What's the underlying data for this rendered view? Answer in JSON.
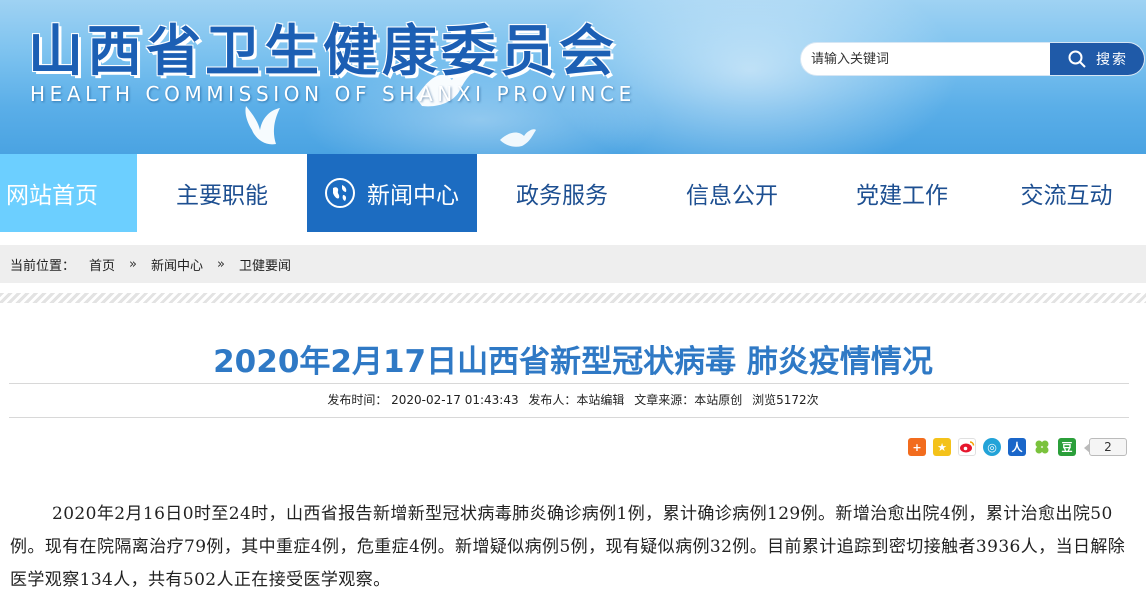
{
  "header": {
    "title": "山西省卫生健康委员会",
    "subtitle": "HEALTH COMMISSION OF SHANXI PROVINCE",
    "search_placeholder": "请输入关键词",
    "search_button": "搜索"
  },
  "nav": {
    "items": [
      {
        "label": "网站首页"
      },
      {
        "label": "主要职能"
      },
      {
        "label": "新闻中心"
      },
      {
        "label": "政务服务"
      },
      {
        "label": "信息公开"
      },
      {
        "label": "党建工作"
      },
      {
        "label": "交流互动"
      }
    ],
    "active_index": 2
  },
  "breadcrumb": {
    "label": "当前位置：",
    "items": [
      "首页",
      "新闻中心",
      "卫健要闻"
    ],
    "separator": "»"
  },
  "article": {
    "title": "2020年2月17日山西省新型冠状病毒 肺炎疫情情况",
    "meta": {
      "publish_time": "发布时间：  2020-02-17 01:43:43",
      "publisher": "发布人：本站编辑",
      "source": "文章来源：本站原创",
      "views": "浏览5172次"
    },
    "share_count": "2",
    "body": "2020年2月16日0时至24时，山西省报告新增新型冠状病毒肺炎确诊病例1例，累计确诊病例129例。新增治愈出院4例，累计治愈出院50例。现有在院隔离治疗79例，其中重症4例，危重症4例。新增疑似病例5例，现有疑似病例32例。目前累计追踪到密切接触者3936人，当日解除医学观察134人，共有502人正在接受医学观察。"
  },
  "colors": {
    "brand_blue": "#1c5fb4",
    "nav_active": "#1c6cc1",
    "nav_home": "#6ccfff",
    "title_blue": "#2f79c5",
    "search_button": "#1f5aa8"
  },
  "icons": {
    "search": "search-icon",
    "globe": "globe-icon",
    "share": [
      "plus-share-icon",
      "qzone-star-icon",
      "weibo-icon",
      "tencent-weibo-icon",
      "renren-icon",
      "kaixin-icon",
      "douban-icon"
    ]
  }
}
